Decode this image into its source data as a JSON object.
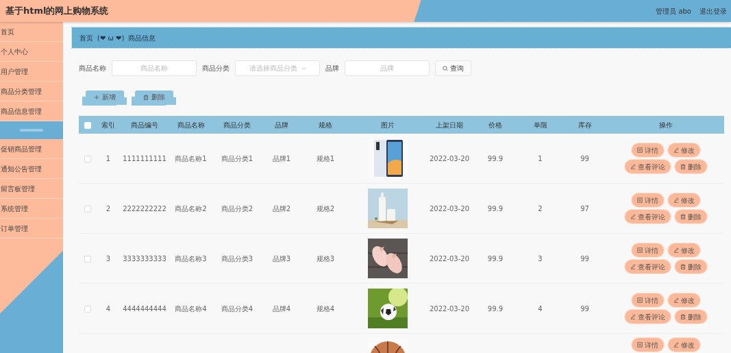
{
  "header": {
    "title": "基于html的网上购物系统",
    "user": "管理员 abo",
    "logout": "退出登录"
  },
  "sidebar": {
    "items": [
      {
        "label": "首页",
        "kind": "link",
        "expanded": false
      },
      {
        "label": "个人中心",
        "kind": "menu",
        "expanded": false
      },
      {
        "label": "用户管理",
        "kind": "menu",
        "expanded": false
      },
      {
        "label": "商品分类管理",
        "kind": "menu",
        "expanded": false
      },
      {
        "label": "商品信息管理",
        "kind": "menu",
        "expanded": true
      },
      {
        "label": "促销商品管理",
        "kind": "menu",
        "expanded": false
      },
      {
        "label": "通知公告管理",
        "kind": "menu",
        "expanded": false
      },
      {
        "label": "留言板管理",
        "kind": "menu",
        "expanded": false
      },
      {
        "label": "系统管理",
        "kind": "menu",
        "expanded": false
      },
      {
        "label": "订单管理",
        "kind": "menu",
        "expanded": false
      }
    ]
  },
  "breadcrumb": [
    "首页",
    "(❤ ω ❤)",
    "商品信息"
  ],
  "search": {
    "fields": [
      {
        "label": "商品名称",
        "placeholder": "商品名称",
        "kind": "text"
      },
      {
        "label": "商品分类",
        "placeholder": "请选择商品分类",
        "kind": "select"
      },
      {
        "label": "品牌",
        "placeholder": "品牌",
        "kind": "text"
      }
    ],
    "button": "查询"
  },
  "toolbar": [
    {
      "label": "新增",
      "kind": "add"
    },
    {
      "label": "删除",
      "kind": "delete"
    }
  ],
  "table": {
    "header_checked": false,
    "columns": [
      "索引",
      "商品编号",
      "商品名称",
      "商品分类",
      "品牌",
      "规格",
      "图片",
      "上架日期",
      "价格",
      "单限",
      "库存",
      "操作"
    ],
    "rows": [
      {
        "selected": false,
        "cells": [
          "1",
          "1111111111",
          "商品名称1",
          "商品分类1",
          "品牌1",
          "规格1"
        ],
        "image": {
          "kind": "picture"
        },
        "cells2": [
          "2022-03-20",
          "99.9",
          "1",
          "99"
        ],
        "actions": [
          {
            "label": "详情",
            "kind": "detail"
          },
          {
            "label": "修改",
            "kind": "edit"
          },
          {
            "label": "查看评论",
            "kind": "comments"
          },
          {
            "label": "删除",
            "kind": "delete"
          }
        ]
      },
      {
        "selected": false,
        "cells": [
          "2",
          "2222222222",
          "商品名称2",
          "商品分类2",
          "品牌2",
          "规格2"
        ],
        "image": {
          "kind": "picture"
        },
        "cells2": [
          "2022-03-20",
          "99.9",
          "2",
          "97"
        ],
        "actions": [
          {
            "label": "详情",
            "kind": "detail"
          },
          {
            "label": "修改",
            "kind": "edit"
          },
          {
            "label": "查看评论",
            "kind": "comments"
          },
          {
            "label": "删除",
            "kind": "delete"
          }
        ]
      },
      {
        "selected": false,
        "cells": [
          "3",
          "3333333333",
          "商品名称3",
          "商品分类3",
          "品牌3",
          "规格3"
        ],
        "image": {
          "kind": "picture"
        },
        "cells2": [
          "2022-03-20",
          "99.9",
          "3",
          "99"
        ],
        "actions": [
          {
            "label": "详情",
            "kind": "detail"
          },
          {
            "label": "修改",
            "kind": "edit"
          },
          {
            "label": "查看评论",
            "kind": "comments"
          },
          {
            "label": "删除",
            "kind": "delete"
          }
        ]
      },
      {
        "selected": false,
        "cells": [
          "4",
          "4444444444",
          "商品名称4",
          "商品分类4",
          "品牌4",
          "规格4"
        ],
        "image": {
          "kind": "picture"
        },
        "cells2": [
          "2022-03-20",
          "99.9",
          "4",
          "99"
        ],
        "actions": [
          {
            "label": "详情",
            "kind": "detail"
          },
          {
            "label": "修改",
            "kind": "edit"
          },
          {
            "label": "查看评论",
            "kind": "comments"
          },
          {
            "label": "删除",
            "kind": "delete"
          }
        ]
      },
      {
        "image": {
          "kind": "picture"
        },
        "actions": [
          {
            "label": "详情",
            "kind": "detail"
          },
          {
            "label": "修改",
            "kind": "edit"
          }
        ]
      }
    ]
  }
}
